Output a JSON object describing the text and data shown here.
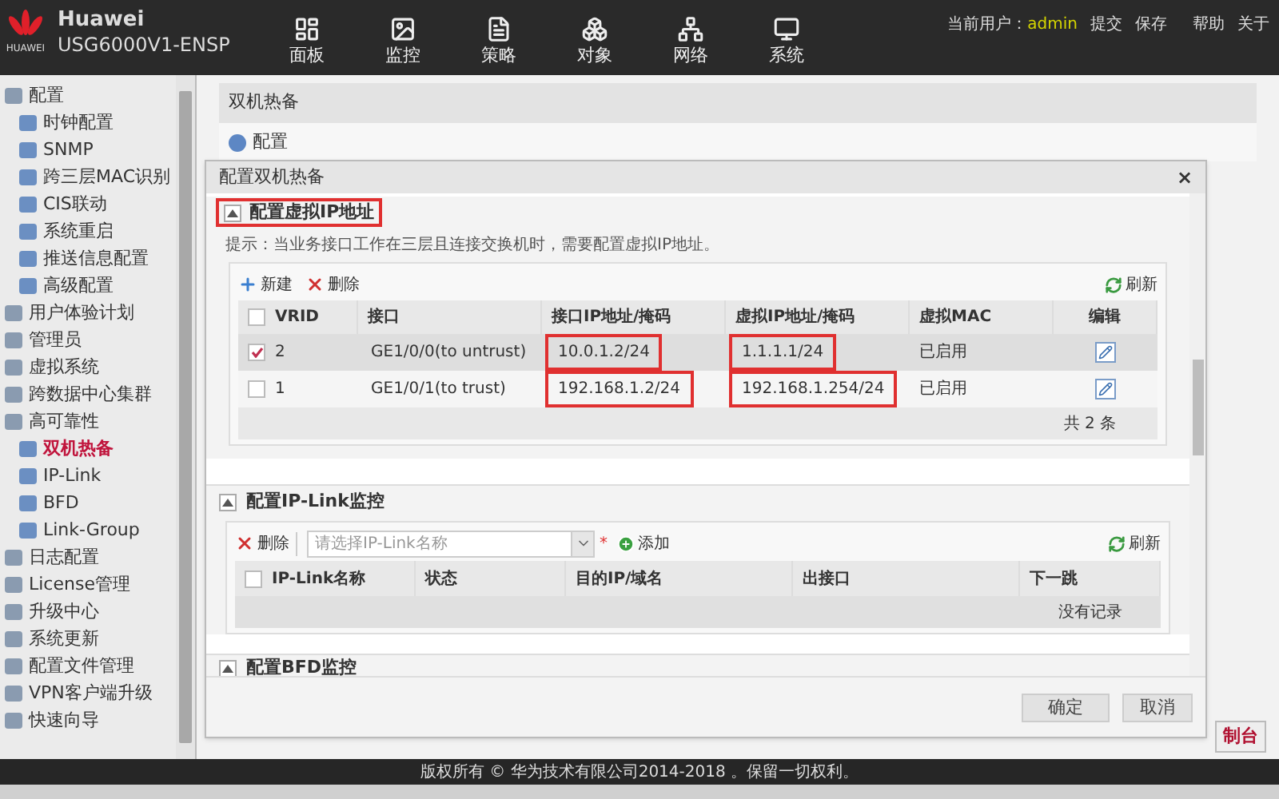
{
  "header": {
    "brand": "Huawei",
    "model": "USG6000V1-ENSP",
    "logo_text": "HUAWEI",
    "nav": [
      {
        "label": "面板",
        "selected": false
      },
      {
        "label": "监控",
        "selected": false
      },
      {
        "label": "策略",
        "selected": false
      },
      {
        "label": "对象",
        "selected": false
      },
      {
        "label": "网络",
        "selected": false
      },
      {
        "label": "系统",
        "selected": false
      }
    ],
    "user_label": "当前用户：",
    "user": "admin",
    "links": [
      "提交",
      "保存",
      "帮助",
      "关于"
    ]
  },
  "sidebar": {
    "items": [
      {
        "label": "配置",
        "selected": false,
        "children": [
          {
            "label": "时钟配置",
            "selected": false
          },
          {
            "label": "SNMP",
            "selected": false
          },
          {
            "label": "跨三层MAC识别",
            "selected": false
          },
          {
            "label": "CIS联动",
            "selected": false
          },
          {
            "label": "系统重启",
            "selected": false
          },
          {
            "label": "推送信息配置",
            "selected": false
          },
          {
            "label": "高级配置",
            "selected": false
          }
        ]
      },
      {
        "label": "用户体验计划",
        "selected": false
      },
      {
        "label": "管理员",
        "selected": false
      },
      {
        "label": "虚拟系统",
        "selected": false
      },
      {
        "label": "跨数据中心集群",
        "selected": false
      },
      {
        "label": "高可靠性",
        "selected": false,
        "children": [
          {
            "label": "双机热备",
            "selected": true
          },
          {
            "label": "IP-Link",
            "selected": false
          },
          {
            "label": "BFD",
            "selected": false
          },
          {
            "label": "Link-Group",
            "selected": false
          }
        ]
      },
      {
        "label": "日志配置",
        "selected": false
      },
      {
        "label": "License管理",
        "selected": false
      },
      {
        "label": "升级中心",
        "selected": false
      },
      {
        "label": "系统更新",
        "selected": false
      },
      {
        "label": "配置文件管理",
        "selected": false
      },
      {
        "label": "VPN客户端升级",
        "selected": false
      },
      {
        "label": "快速向导",
        "selected": false
      }
    ]
  },
  "page": {
    "title": "双机热备",
    "tab": "配置"
  },
  "dialog": {
    "title": "配置双机热备",
    "close": "×",
    "vip_section": {
      "title": "配置虚拟IP地址",
      "expanded": true,
      "highlighted": true,
      "hint": "提示：当业务接口工作在三层且连接交换机时，需要配置虚拟IP地址。",
      "new": "新建",
      "delete": "删除",
      "refresh": "刷新",
      "select_all_checked": false,
      "columns": [
        "VRID",
        "接口",
        "接口IP地址/掩码",
        "虚拟IP地址/掩码",
        "虚拟MAC",
        "编辑"
      ],
      "rows": [
        {
          "checked": true,
          "vrid": "2",
          "interface": "GE1/0/0(to untrust)",
          "ip": {
            "text": "10.0.1.2/24",
            "highlighted": true
          },
          "vip": {
            "text": "1.1.1.1/24",
            "highlighted": true
          },
          "mac": "已启用"
        },
        {
          "checked": false,
          "vrid": "1",
          "interface": "GE1/0/1(to trust)",
          "ip": {
            "text": "192.168.1.2/24",
            "highlighted": true
          },
          "vip": {
            "text": "192.168.1.254/24",
            "highlighted": true
          },
          "mac": "已启用"
        }
      ],
      "total": "共 2 条"
    },
    "iplink_section": {
      "title": "配置IP-Link监控",
      "expanded": true,
      "delete": "删除",
      "placeholder": "请选择IP-Link名称",
      "required": "*",
      "add": "添加",
      "refresh": "刷新",
      "select_all_checked": false,
      "columns": [
        "IP-Link名称",
        "状态",
        "目的IP/域名",
        "出接口",
        "下一跳"
      ],
      "empty": "没有记录"
    },
    "bfd_section": {
      "title": "配置BFD监控",
      "expanded": true
    },
    "ok": "确定",
    "cancel": "取消"
  },
  "console_tab": "制台",
  "footer": "版权所有 © 华为技术有限公司2014-2018 。保留一切权利。"
}
